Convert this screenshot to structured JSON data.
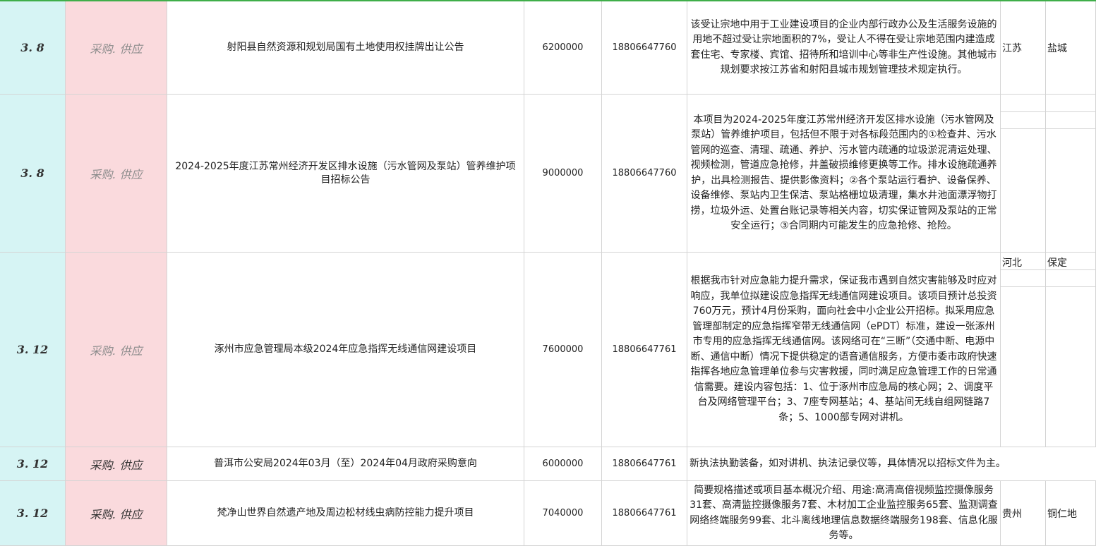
{
  "rows": [
    {
      "date": "3. 8",
      "category": "采购. 供应",
      "title": "射阳县自然资源和规划局国有土地使用权挂牌出让公告",
      "amount": "6200000",
      "phone": "18806647760",
      "description": "该受让宗地中用于工业建设项目的企业内部行政办公及生活服务设施的用地不超过受让宗地面积的7%，受让人不得在受让宗地范围内建造成套住宅、专家楼、宾馆、招待所和培训中心等非生产性设施。其他城市规划要求按江苏省和射阳县城市规划管理技术规定执行。",
      "province": "江苏",
      "city": "盐城"
    },
    {
      "date": "3. 8",
      "category": "采购. 供应",
      "title": "2024-2025年度江苏常州经济开发区排水设施（污水管网及泵站）管养维护项目招标公告",
      "amount": "9000000",
      "phone": "18806647760",
      "description": "本项目为2024-2025年度江苏常州经济开发区排水设施（污水管网及泵站）管养维护项目，包括但不限于对各标段范围内的①检查井、污水管网的巡查、清理、疏通、养护、污水管内疏通的垃圾淤泥清运处理、视频检测，管道应急抢修，井盖破损维修更换等工作。排水设施疏通养护，出具检测报告、提供影像资料；②各个泵站运行看护、设备保养、设备维修、泵站内卫生保洁、泵站格栅垃圾清理，集水井池面漂浮物打捞，垃圾外运、处置台账记录等相关内容，切实保证管网及泵站的正常安全运行；③合同期内可能发生的应急抢修、抢险。",
      "province": "",
      "city": ""
    },
    {
      "date": "3. 12",
      "category": "采购. 供应",
      "title": "涿州市应急管理局本级2024年应急指挥无线通信网建设项目",
      "amount": "7600000",
      "phone": "18806647761",
      "description": "根据我市针对应急能力提升需求，保证我市遇到自然灾害能够及时应对响应，我单位拟建设应急指挥无线通信网建设项目。该项目预计总投资760万元，预计4月份采购，面向社会中小企业公开招标。拟采用应急管理部制定的应急指挥窄带无线通信网（ePDT）标准，建设一张涿州市专用的应急指挥无线通信网。该网络可在“三断”（交通中断、电源中断、通信中断）情况下提供稳定的语音通信服务，方便市委市政府快速指挥各地应急管理单位参与灾害救援，同时满足应急管理工作的日常通信需要。建设内容包括：1、位于涿州市应急局的核心网；2、调度平台及网络管理平台；3、7座专网基站；4、基站间无线自组网链路7条；5、1000部专网对讲机。",
      "province": "河北",
      "city": "保定"
    },
    {
      "date": "3. 12",
      "category": "采购. 供应",
      "title": "普洱市公安局2024年03月（至）2024年04月政府采购意向",
      "amount": "6000000",
      "phone": "18806647761",
      "description": "新执法执勤装备，如对讲机、执法记录仪等，具体情况以招标文件为主。",
      "province": "",
      "city": ""
    },
    {
      "date": "3. 12",
      "category": "采购. 供应",
      "title": "梵净山世界自然遗产地及周边松材线虫病防控能力提升项目",
      "amount": "7040000",
      "phone": "18806647761",
      "description": "简要规格描述或项目基本概况介绍、用途:高清高倍视频监控摄像服务31套、高清监控摄像服务7套、木材加工企业监控服务65套、监测调查网络终端服务99套、北斗离线地理信息数据终端服务198套、信息化服务等。",
      "province": "贵州",
      "city": "铜仁地"
    }
  ]
}
